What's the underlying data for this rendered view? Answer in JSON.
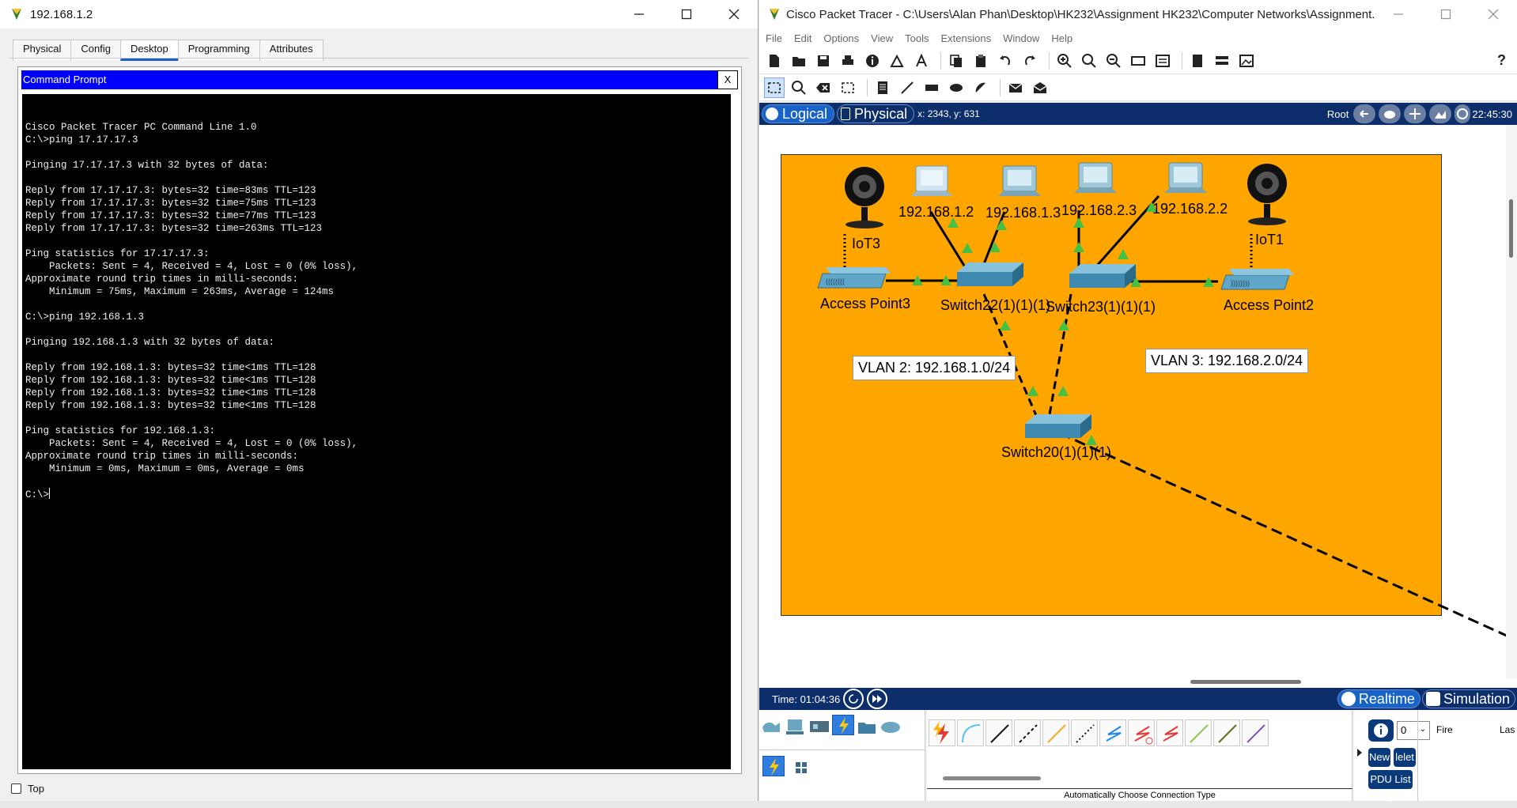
{
  "pc_window": {
    "title": "192.168.1.2",
    "tabs": [
      "Physical",
      "Config",
      "Desktop",
      "Programming",
      "Attributes"
    ],
    "active_tab": "Desktop",
    "cmd_title": "Command Prompt",
    "cmd_close": "X",
    "terminal_lines": [
      "",
      "Cisco Packet Tracer PC Command Line 1.0",
      "C:\\>ping 17.17.17.3",
      "",
      "Pinging 17.17.17.3 with 32 bytes of data:",
      "",
      "Reply from 17.17.17.3: bytes=32 time=83ms TTL=123",
      "Reply from 17.17.17.3: bytes=32 time=75ms TTL=123",
      "Reply from 17.17.17.3: bytes=32 time=77ms TTL=123",
      "Reply from 17.17.17.3: bytes=32 time=263ms TTL=123",
      "",
      "Ping statistics for 17.17.17.3:",
      "    Packets: Sent = 4, Received = 4, Lost = 0 (0% loss),",
      "Approximate round trip times in milli-seconds:",
      "    Minimum = 75ms, Maximum = 263ms, Average = 124ms",
      "",
      "C:\\>ping 192.168.1.3",
      "",
      "Pinging 192.168.1.3 with 32 bytes of data:",
      "",
      "Reply from 192.168.1.3: bytes=32 time<1ms TTL=128",
      "Reply from 192.168.1.3: bytes=32 time<1ms TTL=128",
      "Reply from 192.168.1.3: bytes=32 time<1ms TTL=128",
      "Reply from 192.168.1.3: bytes=32 time<1ms TTL=128",
      "",
      "Ping statistics for 192.168.1.3:",
      "    Packets: Sent = 4, Received = 4, Lost = 0 (0% loss),",
      "Approximate round trip times in milli-seconds:",
      "    Minimum = 0ms, Maximum = 0ms, Average = 0ms",
      "",
      "C:\\>"
    ],
    "top_checkbox_label": "Top"
  },
  "pt_window": {
    "title": "Cisco Packet Tracer - C:\\Users\\Alan Phan\\Desktop\\HK232\\Assignment HK232\\Computer Networks\\Assignment...",
    "menu": [
      "File",
      "Edit",
      "Options",
      "View",
      "Tools",
      "Extensions",
      "Window",
      "Help"
    ],
    "help_label": "?",
    "view_tabs": [
      "Logical",
      "Physical"
    ],
    "coords": "x: 2343, y: 631",
    "root_label": "Root",
    "clock": "22:45:30",
    "time_label": "Time: 01:04:36",
    "mode_realtime": "Realtime",
    "mode_simulation": "Simulation",
    "connection_status": "Automatically Choose Connection Type",
    "pdu_new": "New",
    "pdu_delete": "lelet",
    "pdu_list": "PDU List \\",
    "pdu_count": "0",
    "pdu_col_fire": "Fire",
    "pdu_col_last": "Las"
  },
  "topology": {
    "devices": {
      "pc1": "192.168.1.2",
      "pc2": "192.168.1.3",
      "pc3": "192.168.2.3",
      "pc4": "192.168.2.2",
      "iot3": "IoT3",
      "iot1": "IoT1",
      "ap3": "Access Point3",
      "ap2": "Access Point2",
      "sw22": "Switch22(1)(1)(1)",
      "sw23": "Switch23(1)(1)(1)",
      "sw20": "Switch20(1)(1)(1)"
    },
    "vlan2": "VLAN 2: 192.168.1.0/24",
    "vlan3": "VLAN 3: 192.168.2.0/24",
    "colors": {
      "zone": "#ffa500",
      "link_up": "#44c044"
    }
  }
}
